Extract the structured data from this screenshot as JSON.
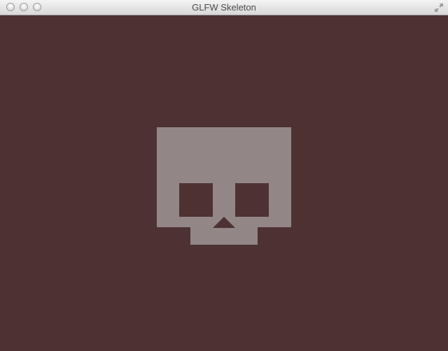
{
  "window": {
    "title": "GLFW Skeleton",
    "controls": {
      "close": "close-button",
      "minimize": "minimize-button",
      "zoom": "zoom-button",
      "fullscreen": "fullscreen-arrows-icon"
    }
  },
  "colors": {
    "background": "#4d3133",
    "skull": "#938686"
  }
}
